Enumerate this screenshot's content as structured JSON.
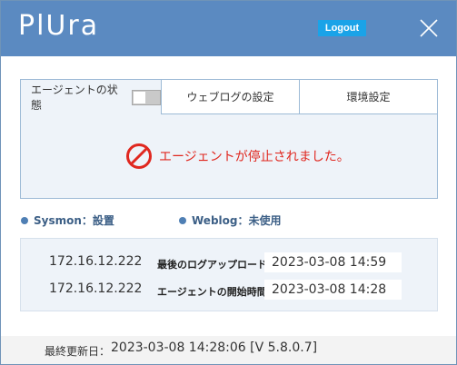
{
  "header": {
    "logo": "PlUra",
    "logout_label": "Logout",
    "close_icon": "close-icon"
  },
  "tabs": [
    {
      "label": "エージェントの状態",
      "active": true
    },
    {
      "label": "ウェブログの設定",
      "active": false
    },
    {
      "label": "環境設定",
      "active": false
    }
  ],
  "status": {
    "icon": "stop-icon",
    "message": "エージェントが停止されました。",
    "color": "#e0271f"
  },
  "services": [
    {
      "label": "Sysmon：設置"
    },
    {
      "label": "Weblog：未使用"
    }
  ],
  "info": {
    "rows": [
      {
        "ip": "172.16.12.222",
        "label": "最後のログアップロード：",
        "value": "2023-03-08 14:59"
      },
      {
        "ip": "172.16.12.222",
        "label": "エージェントの開始時間：",
        "value": "2023-03-08 14:28"
      }
    ]
  },
  "footer": {
    "label": "最終更新日：",
    "value": "2023-03-08 14:28:06 [V 5.8.0.7]"
  },
  "colors": {
    "titlebar": "#5b8ac1",
    "logout": "#1aa3e8",
    "accent_text": "#3c5f86"
  }
}
